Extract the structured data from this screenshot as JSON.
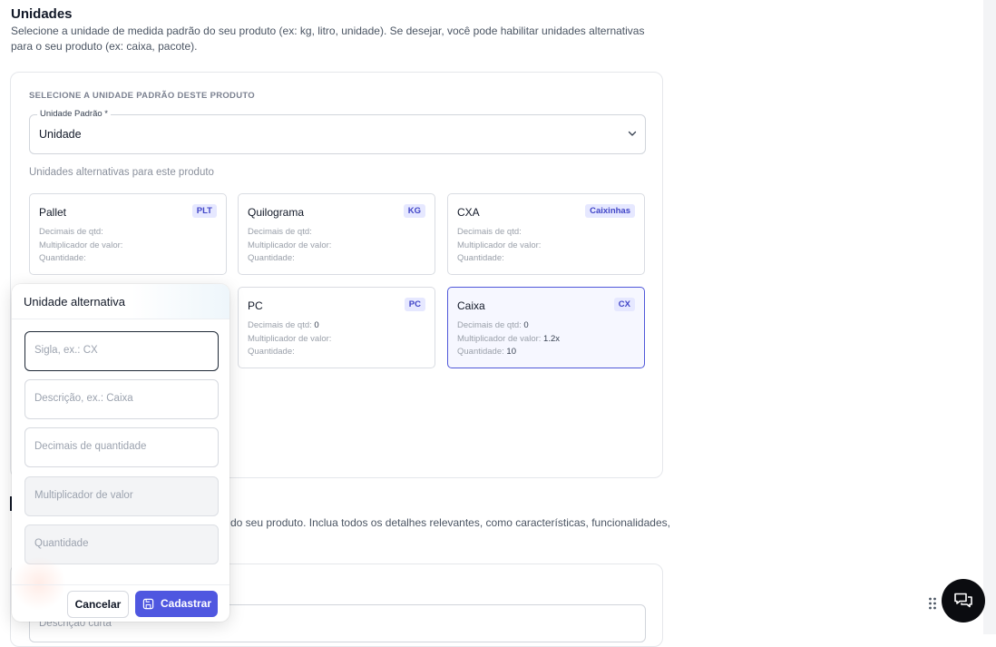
{
  "section": {
    "title": "Unidades",
    "description": "Selecione a unidade de medida padrão do seu produto (ex: kg, litro, unidade). Se desejar, você pode habilitar unidades alternativas para o seu produto (ex: caixa, pacote)."
  },
  "default_unit": {
    "panel_label": "SELECIONE A UNIDADE PADRÃO DESTE PRODUTO",
    "legend": "Unidade Padrão *",
    "value": "Unidade"
  },
  "alternatives": {
    "label": "Unidades alternativas para este produto",
    "field_labels": {
      "decimals": "Decimais de qtd:",
      "multiplier": "Multiplicador de valor:",
      "quantity": "Quantidade:"
    },
    "cards": [
      {
        "name": "Pallet",
        "badge": "PLT",
        "decimals": "",
        "multiplier": "",
        "quantity": "",
        "selected": false
      },
      {
        "name": "Quilograma",
        "badge": "KG",
        "decimals": "",
        "multiplier": "",
        "quantity": "",
        "selected": false
      },
      {
        "name": "CXA",
        "badge": "Caixinhas",
        "decimals": "",
        "multiplier": "",
        "quantity": "",
        "selected": false
      },
      {
        "name": "PC",
        "badge": "PC",
        "decimals": "0",
        "multiplier": "",
        "quantity": "",
        "selected": false
      },
      {
        "name": "Caixa",
        "badge": "CX",
        "decimals": "0",
        "multiplier": "1.2x",
        "quantity": "10",
        "selected": true
      }
    ]
  },
  "description_section": {
    "text": "do seu produto. Inclua todos os detalhes relevantes, como características, funcionalidades,",
    "short_placeholder": "Descrição curta"
  },
  "modal": {
    "title": "Unidade alternativa",
    "fields": {
      "sigla": {
        "placeholder": "Sigla, ex.: CX"
      },
      "descricao": {
        "placeholder": "Descrição, ex.: Caixa"
      },
      "decimais": {
        "placeholder": "Decimais de quantidade"
      },
      "multiplicador": {
        "placeholder": "Multiplicador de valor"
      },
      "quantidade": {
        "placeholder": "Quantidade"
      }
    },
    "cancel_label": "Cancelar",
    "save_label": "Cadastrar"
  },
  "colors": {
    "accent": "#4f57e0",
    "badge_bg": "#e6e8ff",
    "badge_text": "#4045c7",
    "chat_button": "#0b0c10"
  },
  "icons": {
    "chevron": "chevron-down-icon",
    "save": "save-icon",
    "chat": "chat-icon",
    "drag": "drag-handle-icon"
  }
}
